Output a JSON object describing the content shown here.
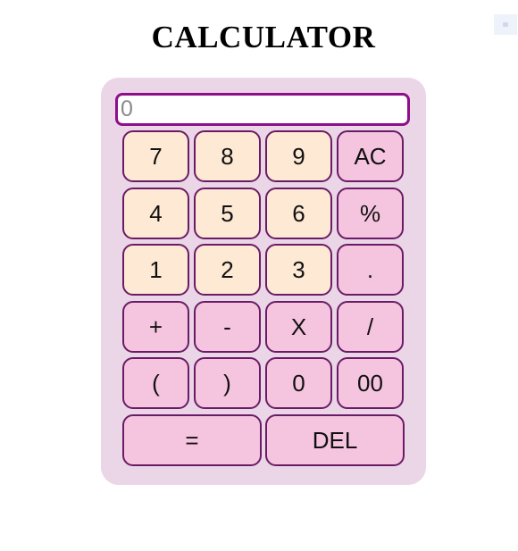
{
  "title": "CALCULATOR",
  "display": {
    "value": "",
    "placeholder": "0"
  },
  "keys": {
    "k7": "7",
    "k8": "8",
    "k9": "9",
    "ac": "AC",
    "k4": "4",
    "k5": "5",
    "k6": "6",
    "percent": "%",
    "k1": "1",
    "k2": "2",
    "k3": "3",
    "dot": ".",
    "plus": "+",
    "minus": "-",
    "multiply": "X",
    "divide": "/",
    "open_paren": "(",
    "close_paren": ")",
    "k0": "0",
    "k00": "00",
    "equals": "=",
    "del": "DEL"
  },
  "colors": {
    "panel": "#ead6e6",
    "display_border": "#8e0f8a",
    "number_key": "#fde9d4",
    "operator_key": "#f5c4df",
    "key_border": "#6b1b66"
  }
}
